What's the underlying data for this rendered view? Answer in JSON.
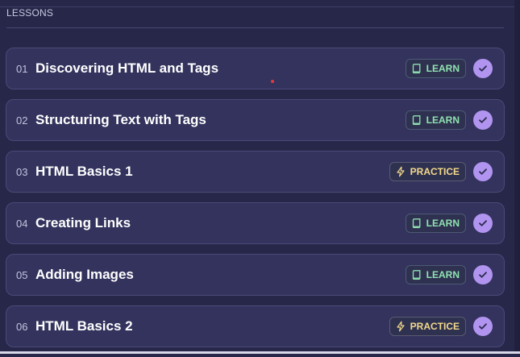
{
  "section": {
    "title": "LESSONS"
  },
  "lessons": [
    {
      "number": "01",
      "title": "Discovering HTML and Tags",
      "type": "learn",
      "badge": "LEARN",
      "completed": true
    },
    {
      "number": "02",
      "title": "Structuring Text with Tags",
      "type": "learn",
      "badge": "LEARN",
      "completed": true
    },
    {
      "number": "03",
      "title": "HTML Basics 1",
      "type": "practice",
      "badge": "PRACTICE",
      "completed": true
    },
    {
      "number": "04",
      "title": "Creating Links",
      "type": "learn",
      "badge": "LEARN",
      "completed": true
    },
    {
      "number": "05",
      "title": "Adding Images",
      "type": "learn",
      "badge": "LEARN",
      "completed": true
    },
    {
      "number": "06",
      "title": "HTML Basics 2",
      "type": "practice",
      "badge": "PRACTICE",
      "completed": true
    }
  ],
  "colors": {
    "background": "#27274a",
    "card": "#33335e",
    "learn": "#8fe2b0",
    "practice": "#f3d98b",
    "check": "#b194ef"
  },
  "icons": {
    "learn": "book-icon",
    "practice": "lightning-icon",
    "completed": "checkmark-icon"
  }
}
